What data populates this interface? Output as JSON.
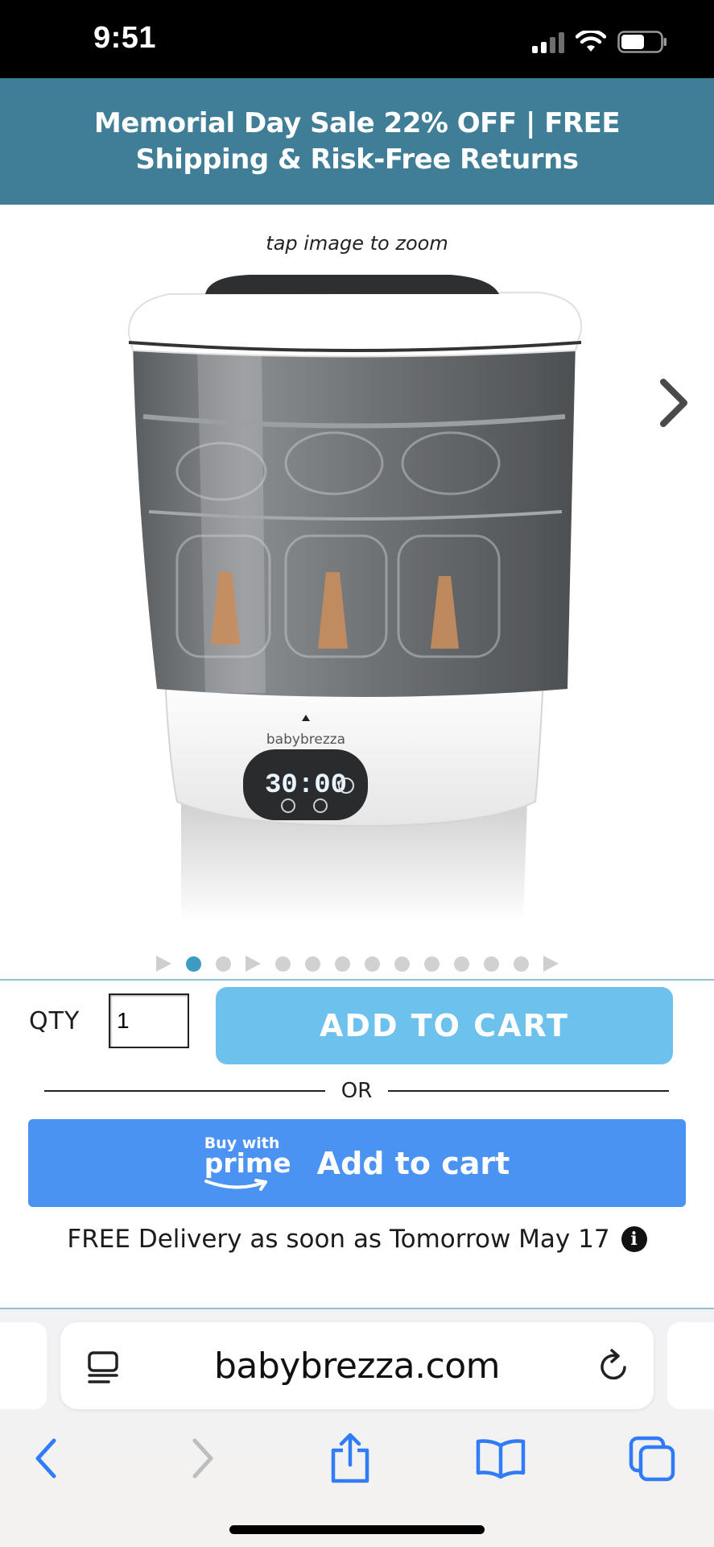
{
  "status_bar": {
    "time": "9:51"
  },
  "promo": {
    "text": "Memorial Day Sale 22% OFF | FREE Shipping & Risk-Free Returns"
  },
  "product": {
    "zoom_hint": "tap image to zoom",
    "brand_on_device": "babybrezza",
    "display_readout": "30:00"
  },
  "carousel": {
    "dot_count": 12,
    "active_index": 0
  },
  "purchase": {
    "qty_label": "QTY",
    "qty_value": "1",
    "add_to_cart_label": "ADD TO CART",
    "or_label": "OR",
    "prime_buy_with": "Buy with",
    "prime_word": "prime",
    "prime_add_label": "Add to cart",
    "delivery_text": "FREE Delivery as soon as Tomorrow May 17",
    "info_glyph": "i"
  },
  "browser": {
    "url": "babybrezza.com",
    "icons": [
      "reader-icon",
      "reload-icon",
      "back-icon",
      "forward-icon",
      "share-icon",
      "bookmarks-icon",
      "tabs-icon"
    ]
  },
  "colors": {
    "banner": "#3f7e96",
    "add_to_cart": "#6cc1ed",
    "prime_button": "#4a93f2",
    "active_dot": "#3e9bc2",
    "ios_blue": "#2f7cf6"
  }
}
